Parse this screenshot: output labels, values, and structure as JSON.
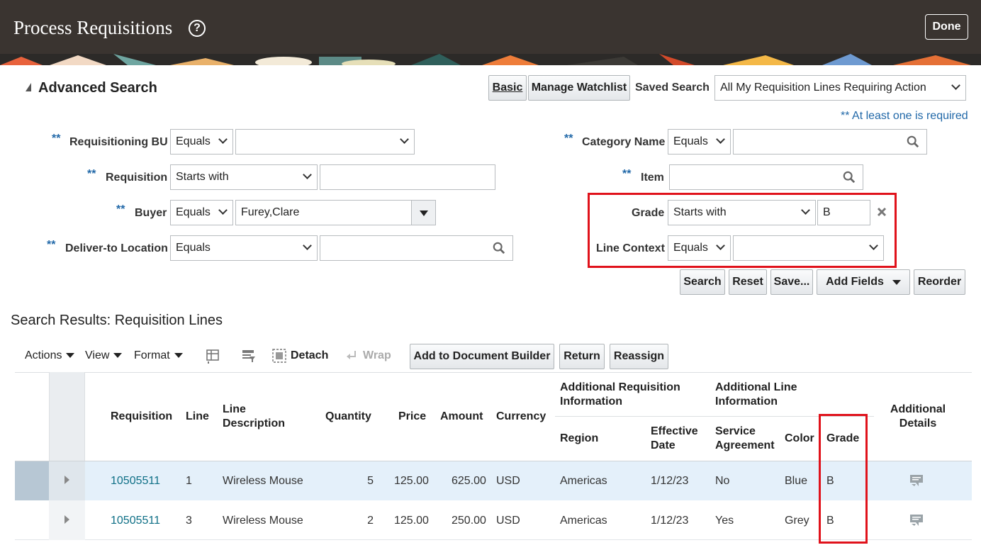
{
  "header": {
    "title": "Process Requisitions",
    "help": "?",
    "done_label": "Done"
  },
  "search": {
    "title": "Advanced Search",
    "basic_label": "Basic",
    "watchlist_label": "Manage Watchlist",
    "saved_search_label": "Saved Search",
    "saved_search_value": "All My Requisition Lines Requiring Action",
    "required_note": "** At least one is required",
    "req_marker": "**",
    "fields": {
      "requisitioning_bu": {
        "label": "Requisitioning BU",
        "operator": "Equals",
        "value": ""
      },
      "requisition": {
        "label": "Requisition",
        "operator": "Starts with",
        "value": ""
      },
      "buyer": {
        "label": "Buyer",
        "operator": "Equals",
        "value": "Furey,Clare"
      },
      "deliver_to": {
        "label": "Deliver-to Location",
        "operator": "Equals",
        "value": ""
      },
      "category_name": {
        "label": "Category Name",
        "operator": "Equals",
        "value": ""
      },
      "item": {
        "label": "Item",
        "value": ""
      },
      "grade": {
        "label": "Grade",
        "operator": "Starts with",
        "value": "B"
      },
      "line_context": {
        "label": "Line Context",
        "operator": "Equals",
        "value": ""
      }
    },
    "buttons": {
      "search": "Search",
      "reset": "Reset",
      "save": "Save...",
      "add_fields": "Add Fields",
      "reorder": "Reorder"
    }
  },
  "results": {
    "title": "Search Results: Requisition Lines",
    "toolbar": {
      "actions": "Actions",
      "view": "View",
      "format": "Format",
      "detach": "Detach",
      "wrap": "Wrap",
      "add_doc_builder": "Add to Document Builder",
      "return": "Return",
      "reassign": "Reassign"
    },
    "columns": {
      "requisition": "Requisition",
      "line": "Line",
      "line_description": "Line Description",
      "quantity": "Quantity",
      "price": "Price",
      "amount": "Amount",
      "currency": "Currency",
      "add_req_info": "Additional Requisition Information",
      "region": "Region",
      "effective_date": "Effective Date",
      "add_line_info": "Additional Line Information",
      "service_agreement": "Service Agreement",
      "color": "Color",
      "grade": "Grade",
      "additional_details": "Additional Details"
    },
    "rows": [
      {
        "requisition": "10505511",
        "line": "1",
        "description": "Wireless Mouse",
        "quantity": "5",
        "price": "125.00",
        "amount": "625.00",
        "currency": "USD",
        "region": "Americas",
        "effective_date": "1/12/23",
        "service_agreement": "No",
        "color": "Blue",
        "grade": "B"
      },
      {
        "requisition": "10505511",
        "line": "3",
        "description": "Wireless Mouse",
        "quantity": "2",
        "price": "125.00",
        "amount": "250.00",
        "currency": "USD",
        "region": "Americas",
        "effective_date": "1/12/23",
        "service_agreement": "Yes",
        "color": "Grey",
        "grade": "B"
      }
    ]
  },
  "colors": {
    "header_bg": "#3a3430",
    "link": "#0e6f86",
    "required": "#2168a8",
    "highlight": "#e0121b",
    "selected_row": "#e4f0fa"
  }
}
